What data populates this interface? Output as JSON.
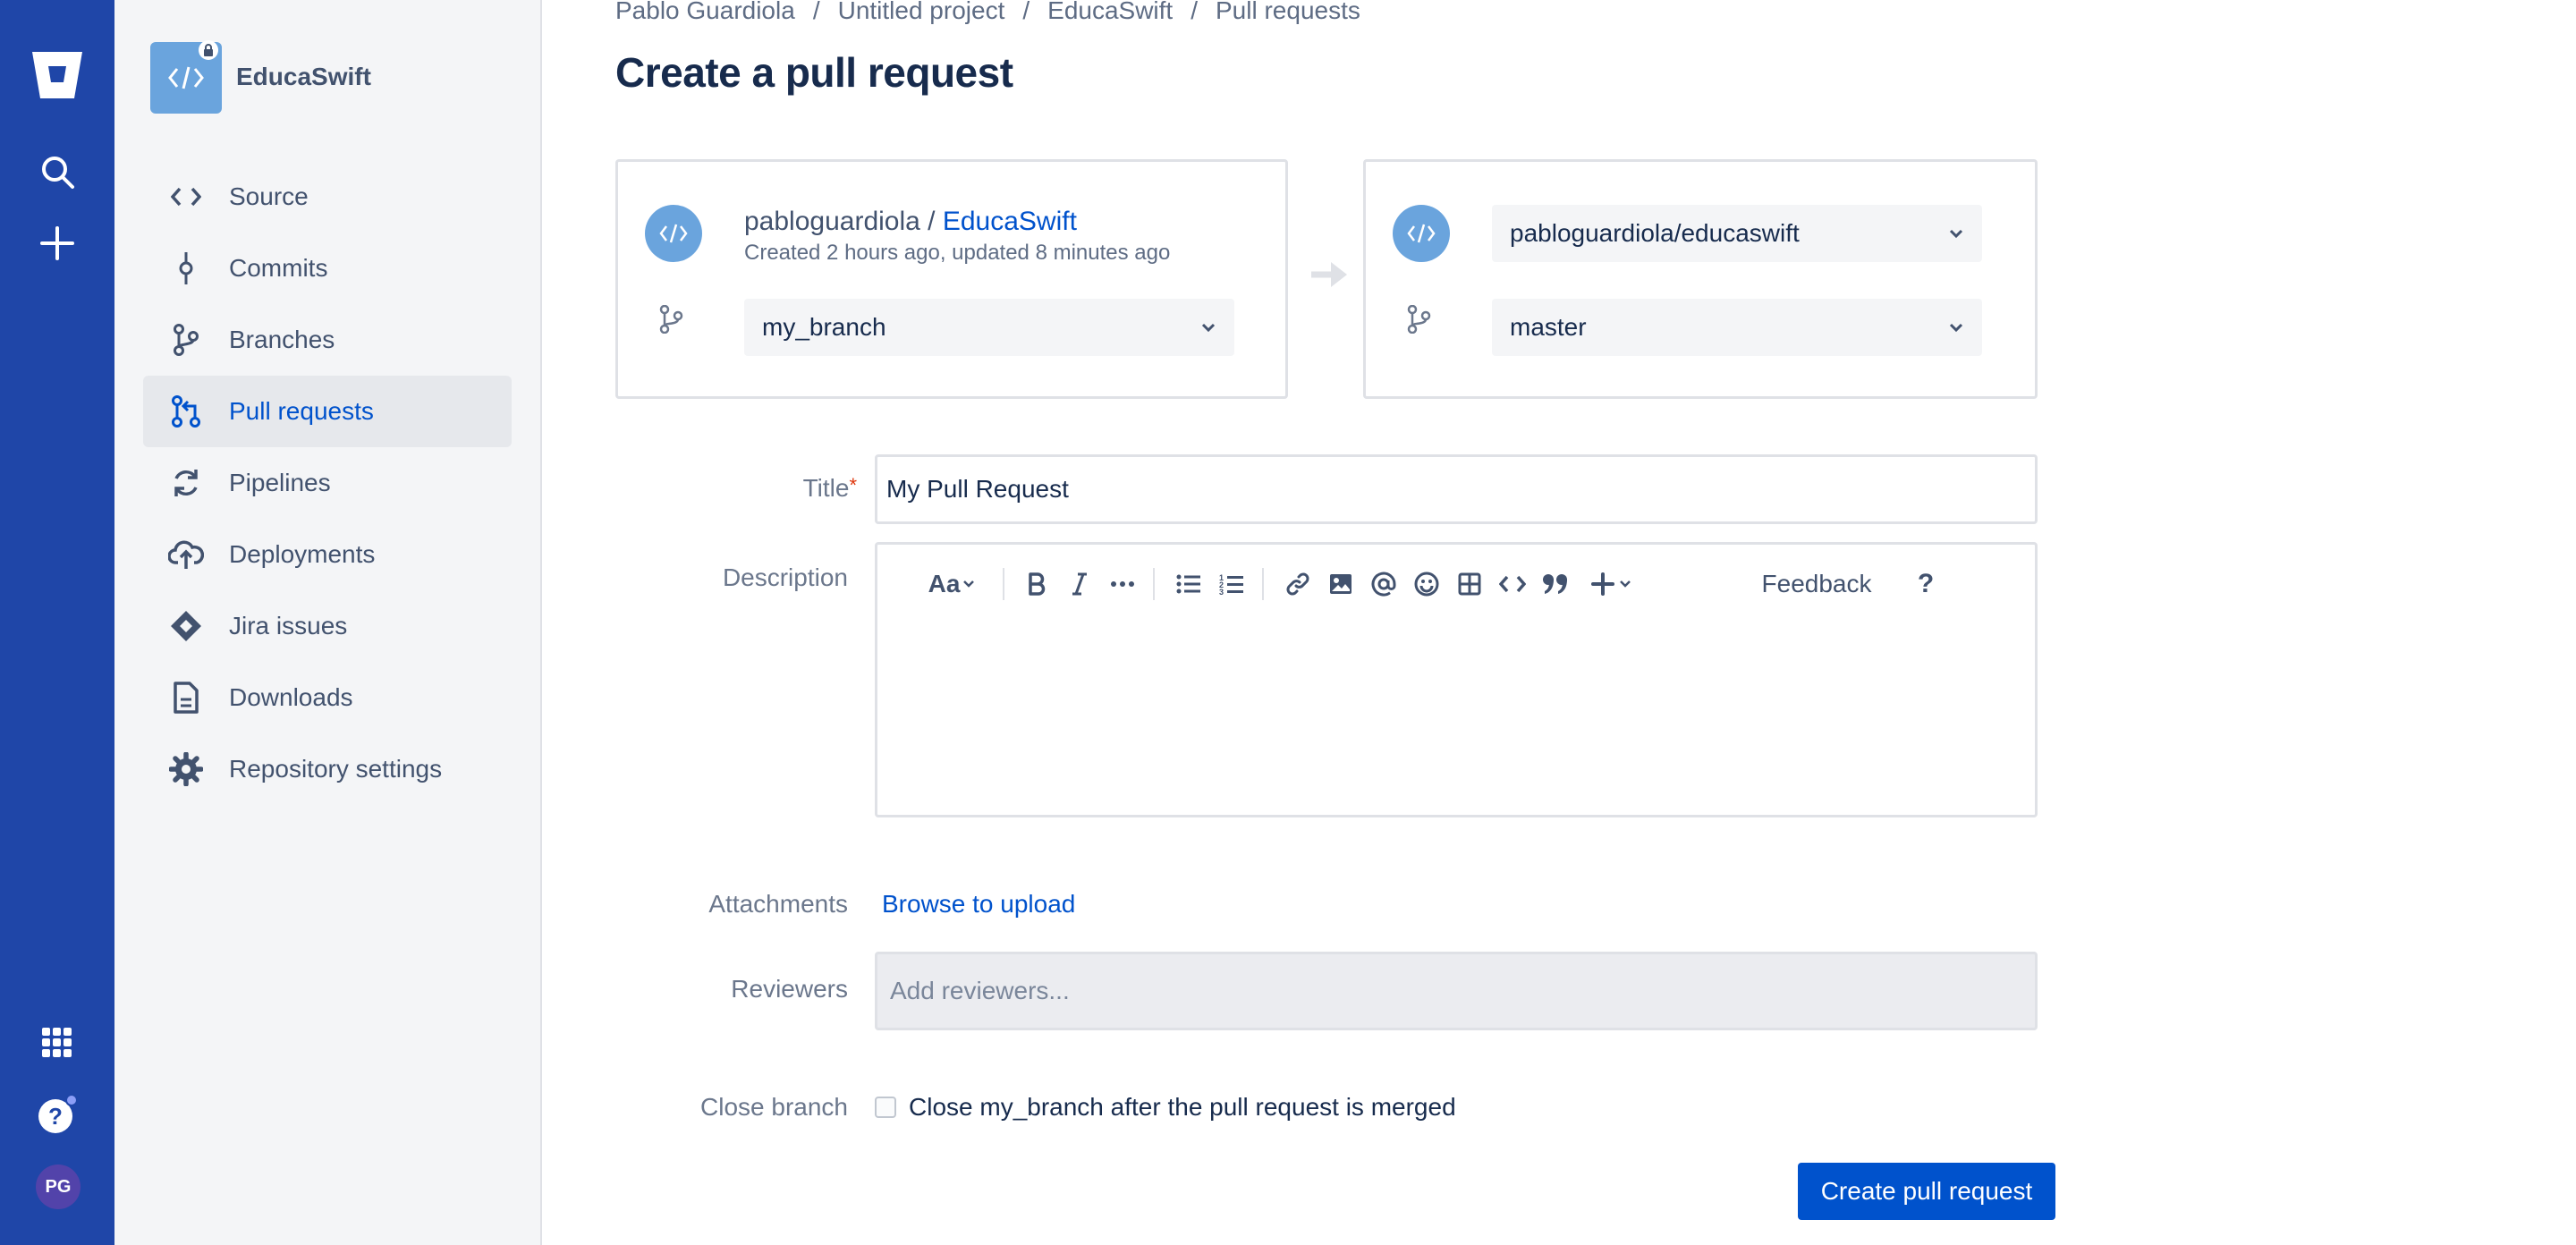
{
  "sidebar": {
    "repo_name": "EducaSwift",
    "items": [
      {
        "label": "Source",
        "icon": "code-icon"
      },
      {
        "label": "Commits",
        "icon": "commit-icon"
      },
      {
        "label": "Branches",
        "icon": "branch-icon"
      },
      {
        "label": "Pull requests",
        "icon": "pull-request-icon",
        "active": true
      },
      {
        "label": "Pipelines",
        "icon": "pipelines-icon"
      },
      {
        "label": "Deployments",
        "icon": "deployments-icon"
      },
      {
        "label": "Jira issues",
        "icon": "jira-icon"
      },
      {
        "label": "Downloads",
        "icon": "downloads-icon"
      },
      {
        "label": "Repository settings",
        "icon": "gear-icon"
      }
    ]
  },
  "global_nav": {
    "avatar_initials": "PG"
  },
  "breadcrumb": [
    "Pablo Guardiola",
    "Untitled project",
    "EducaSwift",
    "Pull requests"
  ],
  "page_title": "Create a pull request",
  "source": {
    "owner": "pabloguardiola / ",
    "repo": "EducaSwift",
    "meta": "Created 2 hours ago, updated 8 minutes ago",
    "branch": "my_branch"
  },
  "destination": {
    "repo": "pabloguardiola/educaswift",
    "branch": "master"
  },
  "form": {
    "title_label": "Title",
    "title_value": "My Pull Request",
    "description_label": "Description",
    "attachments_label": "Attachments",
    "attachments_link": "Browse to upload",
    "reviewers_label": "Reviewers",
    "reviewers_placeholder": "Add reviewers...",
    "close_branch_label": "Close branch",
    "close_branch_text": "Close my_branch after the pull request is merged",
    "close_branch_checked": false
  },
  "editor_toolbar": {
    "text_style": "Aa",
    "feedback": "Feedback",
    "help": "?"
  },
  "actions": {
    "create": "Create pull request"
  },
  "colors": {
    "primary": "#0052cc",
    "nav_bg": "#1f46a8",
    "sidebar_bg": "#f4f5f7",
    "repo_avatar": "#6aa4dd"
  }
}
